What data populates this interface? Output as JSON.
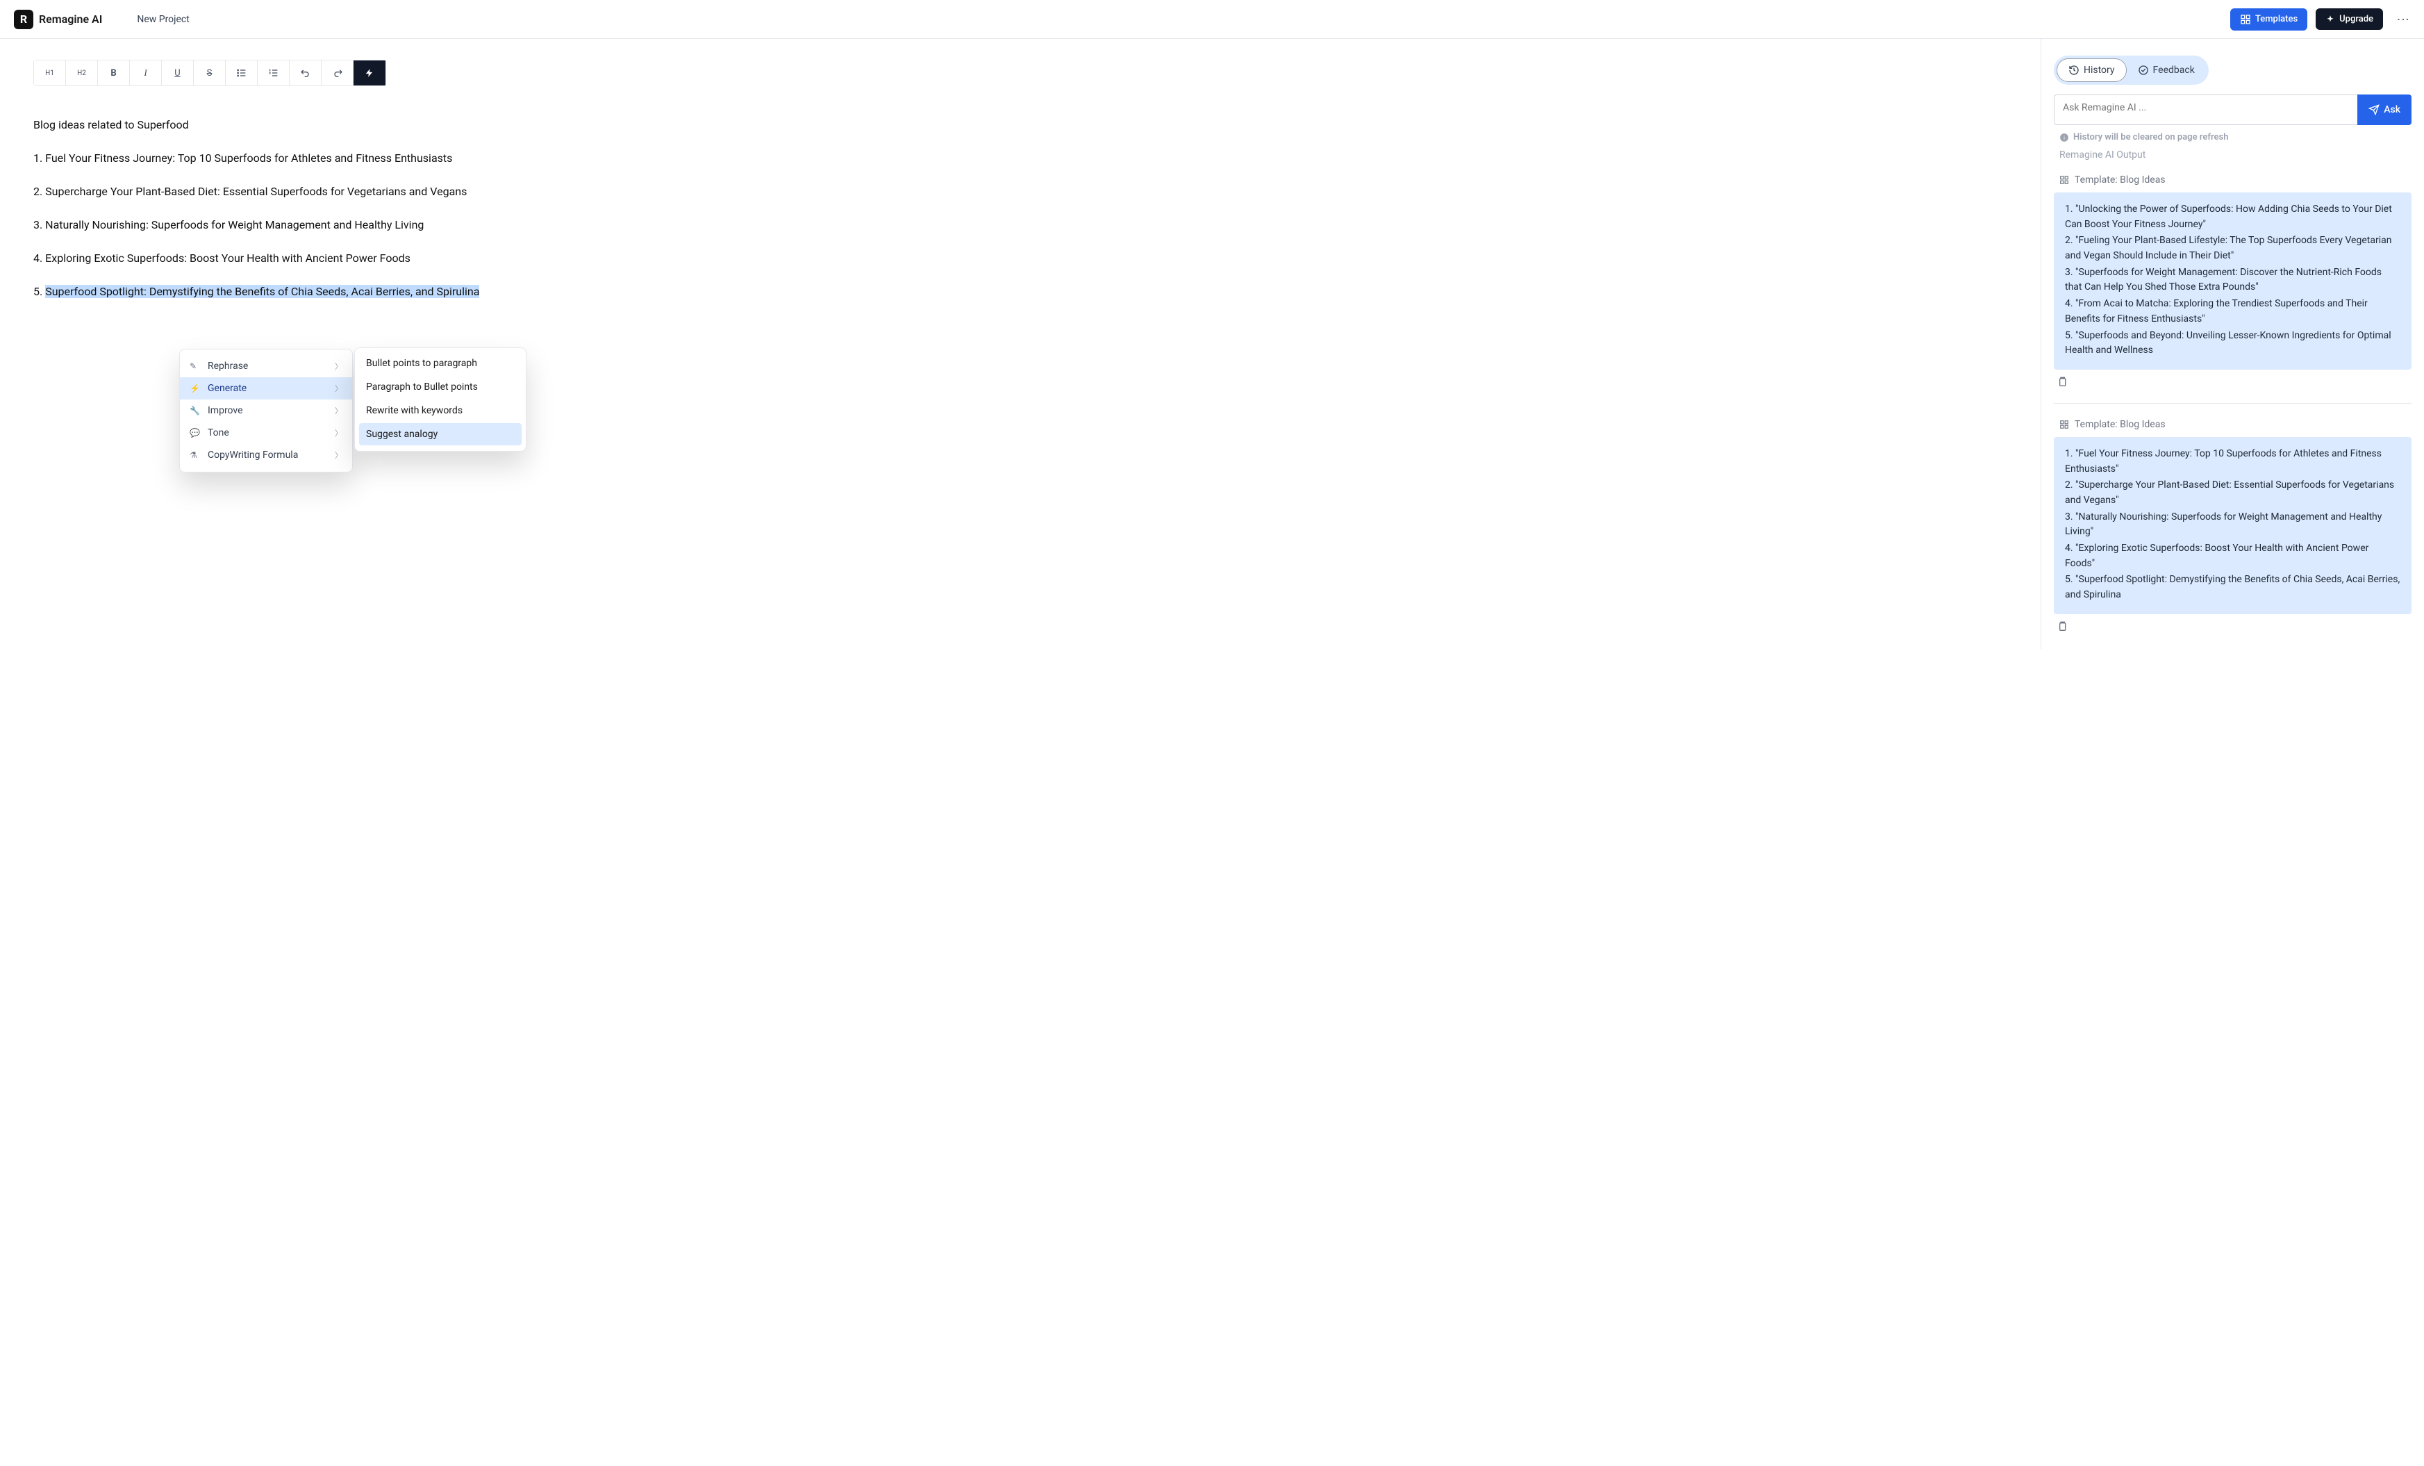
{
  "header": {
    "logo_letter": "R",
    "logo_text": "Remagine AI",
    "project_title": "New Project",
    "templates_label": "Templates",
    "upgrade_label": "Upgrade"
  },
  "toolbar": {
    "h1": "H1",
    "h2": "H2",
    "bold": "B",
    "italic": "I",
    "underline": "U",
    "strike": "S",
    "ul": "≔",
    "ol": "≔",
    "undo": "↶",
    "redo": "↷",
    "ai": "⚡"
  },
  "document": {
    "title": "Blog ideas related to Superfood",
    "items": [
      "1. Fuel Your Fitness Journey: Top 10 Superfoods for Athletes and Fitness Enthusiasts",
      "2. Supercharge Your Plant-Based Diet: Essential Superfoods for Vegetarians and Vegans",
      "3. Naturally Nourishing: Superfoods for Weight Management and Healthy Living",
      "4. Exploring Exotic Superfoods: Boost Your Health with Ancient Power Foods"
    ],
    "selected_prefix": "5. ",
    "selected_text": "Superfood Spotlight: Demystifying the Benefits of Chia Seeds, Acai Berries, and Spirulina"
  },
  "context_menu": {
    "items": [
      {
        "icon": "✎",
        "label": "Rephrase"
      },
      {
        "icon": "⚡",
        "label": "Generate",
        "active": true
      },
      {
        "icon": "🔧",
        "label": "Improve"
      },
      {
        "icon": "💬",
        "label": "Tone"
      },
      {
        "icon": "⚗",
        "label": "CopyWriting Formula"
      }
    ],
    "submenu": [
      {
        "label": "Bullet points to paragraph"
      },
      {
        "label": "Paragraph to Bullet points"
      },
      {
        "label": "Rewrite with keywords"
      },
      {
        "label": "Suggest analogy",
        "active": true
      }
    ]
  },
  "sidebar": {
    "tab_history": "History",
    "tab_feedback": "Feedback",
    "ask_placeholder": "Ask Remagine AI ...",
    "ask_label": "Ask",
    "history_note": "History will be cleared on page refresh",
    "output_label": "Remagine AI Output",
    "cards": [
      {
        "template": "Template: Blog Ideas",
        "lines": [
          "1. \"Unlocking the Power of Superfoods: How Adding Chia Seeds to Your Diet Can Boost Your Fitness Journey\"",
          "2. \"Fueling Your Plant-Based Lifestyle: The Top Superfoods Every Vegetarian and Vegan Should Include in Their Diet\"",
          "3. \"Superfoods for Weight Management: Discover the Nutrient-Rich Foods that Can Help You Shed Those Extra Pounds\"",
          "4. \"From Acai to Matcha: Exploring the Trendiest Superfoods and Their Benefits for Fitness Enthusiasts\"",
          "5. \"Superfoods and Beyond: Unveiling Lesser-Known Ingredients for Optimal Health and Wellness"
        ]
      },
      {
        "template": "Template: Blog Ideas",
        "lines": [
          "1. \"Fuel Your Fitness Journey: Top 10 Superfoods for Athletes and Fitness Enthusiasts\"",
          "2. \"Supercharge Your Plant-Based Diet: Essential Superfoods for Vegetarians and Vegans\"",
          "3. \"Naturally Nourishing: Superfoods for Weight Management and Healthy Living\"",
          "4. \"Exploring Exotic Superfoods: Boost Your Health with Ancient Power Foods\"",
          "5. \"Superfood Spotlight: Demystifying the Benefits of Chia Seeds, Acai Berries, and Spirulina"
        ]
      }
    ]
  }
}
